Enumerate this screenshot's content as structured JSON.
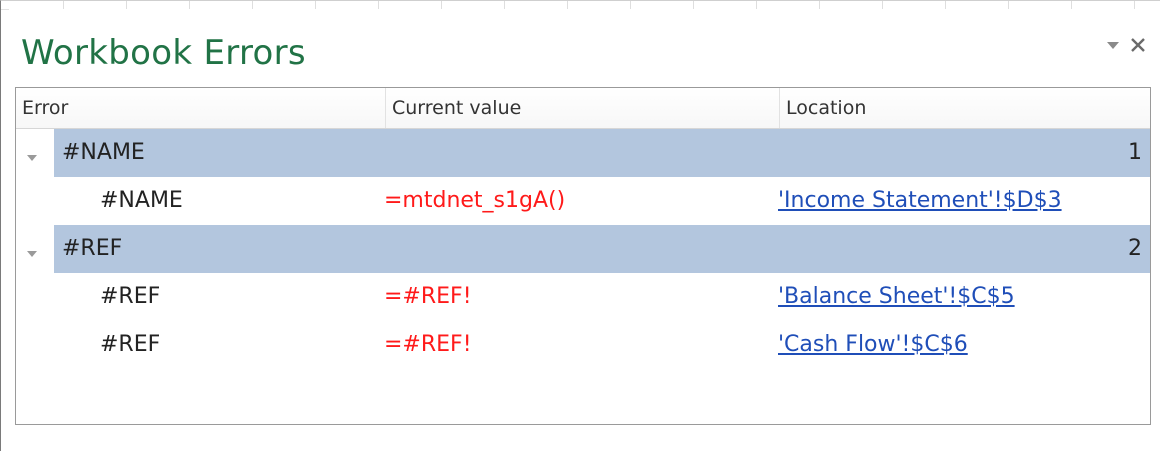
{
  "pane": {
    "title": "Workbook Errors"
  },
  "grid": {
    "columns": [
      "Error",
      "Current value",
      "Location"
    ],
    "groups": [
      {
        "label": "#NAME",
        "count": "1",
        "items": [
          {
            "error": "#NAME",
            "value": "=mtdnet_s1gA()",
            "location": "'Income Statement'!$D$3"
          }
        ]
      },
      {
        "label": "#REF",
        "count": "2",
        "items": [
          {
            "error": "#REF",
            "value": "=#REF!",
            "location": "'Balance Sheet'!$C$5"
          },
          {
            "error": "#REF",
            "value": "=#REF!",
            "location": "'Cash Flow'!$C$6"
          }
        ]
      }
    ]
  },
  "colors": {
    "title": "#217346",
    "group_band": "#b3c6de",
    "value_text": "#ff1a1a",
    "link": "#1f4eb8"
  },
  "icons": [
    "chevron-down-icon",
    "close-icon",
    "collapse-triangle-icon"
  ]
}
